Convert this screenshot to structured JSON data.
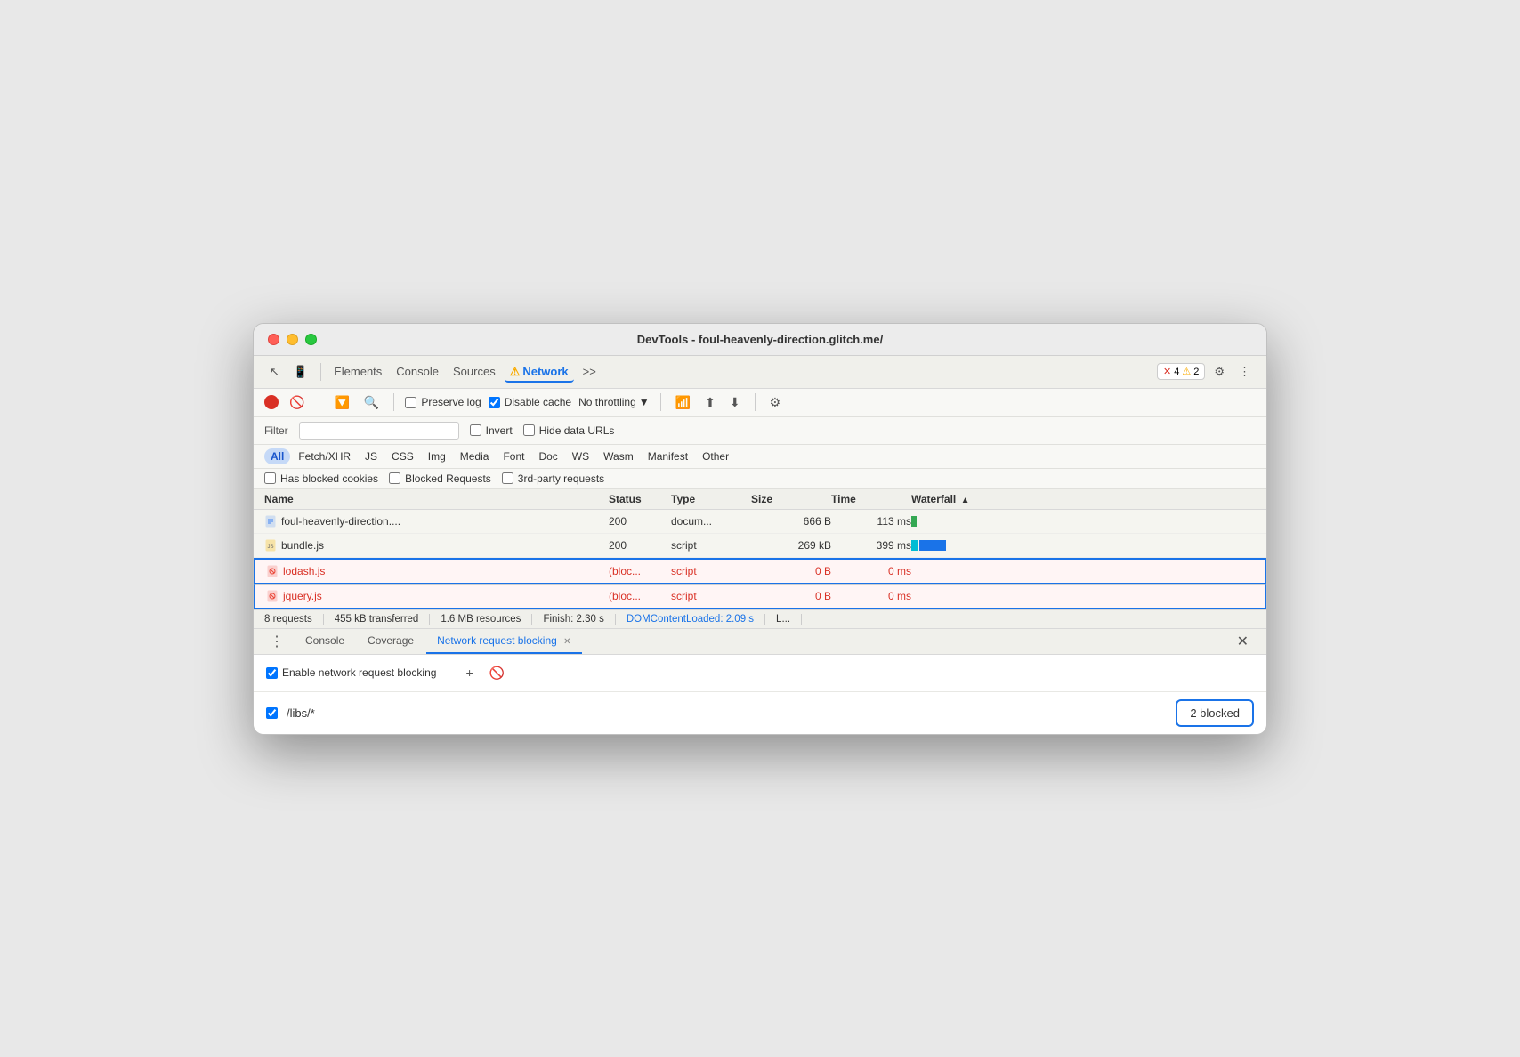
{
  "window": {
    "title": "DevTools - foul-heavenly-direction.glitch.me/"
  },
  "toolbar": {
    "tabs": [
      "Elements",
      "Console",
      "Sources",
      "Network",
      ">>"
    ],
    "network_active": true,
    "network_warning": true,
    "error_count": "4",
    "warning_count": "2"
  },
  "network_toolbar": {
    "preserve_log_label": "Preserve log",
    "disable_cache_label": "Disable cache",
    "no_throttling_label": "No throttling"
  },
  "filter": {
    "label": "Filter",
    "invert_label": "Invert",
    "hide_data_urls_label": "Hide data URLs"
  },
  "type_filters": {
    "items": [
      "All",
      "Fetch/XHR",
      "JS",
      "CSS",
      "Img",
      "Media",
      "Font",
      "Doc",
      "WS",
      "Wasm",
      "Manifest",
      "Other"
    ],
    "active": "All"
  },
  "extra_filters": {
    "has_blocked_cookies": "Has blocked cookies",
    "blocked_requests": "Blocked Requests",
    "third_party": "3rd-party requests"
  },
  "table": {
    "headers": [
      "Name",
      "Status",
      "Type",
      "Size",
      "Time",
      "Waterfall"
    ],
    "rows": [
      {
        "name": "foul-heavenly-direction....",
        "status": "200",
        "type": "docum...",
        "size": "666 B",
        "time": "113 ms",
        "icon_type": "document",
        "blocked": false
      },
      {
        "name": "bundle.js",
        "status": "200",
        "type": "script",
        "size": "269 kB",
        "time": "399 ms",
        "icon_type": "script_yellow",
        "blocked": false
      },
      {
        "name": "lodash.js",
        "status": "(bloc...",
        "type": "script",
        "size": "0 B",
        "time": "0 ms",
        "icon_type": "script_blocked",
        "blocked": true
      },
      {
        "name": "jquery.js",
        "status": "(bloc...",
        "type": "script",
        "size": "0 B",
        "time": "0 ms",
        "icon_type": "script_blocked",
        "blocked": true
      }
    ]
  },
  "status_bar": {
    "requests": "8 requests",
    "transferred": "455 kB transferred",
    "resources": "1.6 MB resources",
    "finish": "Finish: 2.30 s",
    "dom_content_loaded": "DOMContentLoaded: 2.09 s",
    "load": "L..."
  },
  "bottom_panel": {
    "tabs": [
      "Console",
      "Coverage",
      "Network request blocking"
    ],
    "active_tab": "Network request blocking",
    "enable_label": "Enable network request blocking",
    "add_icon": "+",
    "pattern": "/libs/*",
    "blocked_badge": "2 blocked"
  }
}
